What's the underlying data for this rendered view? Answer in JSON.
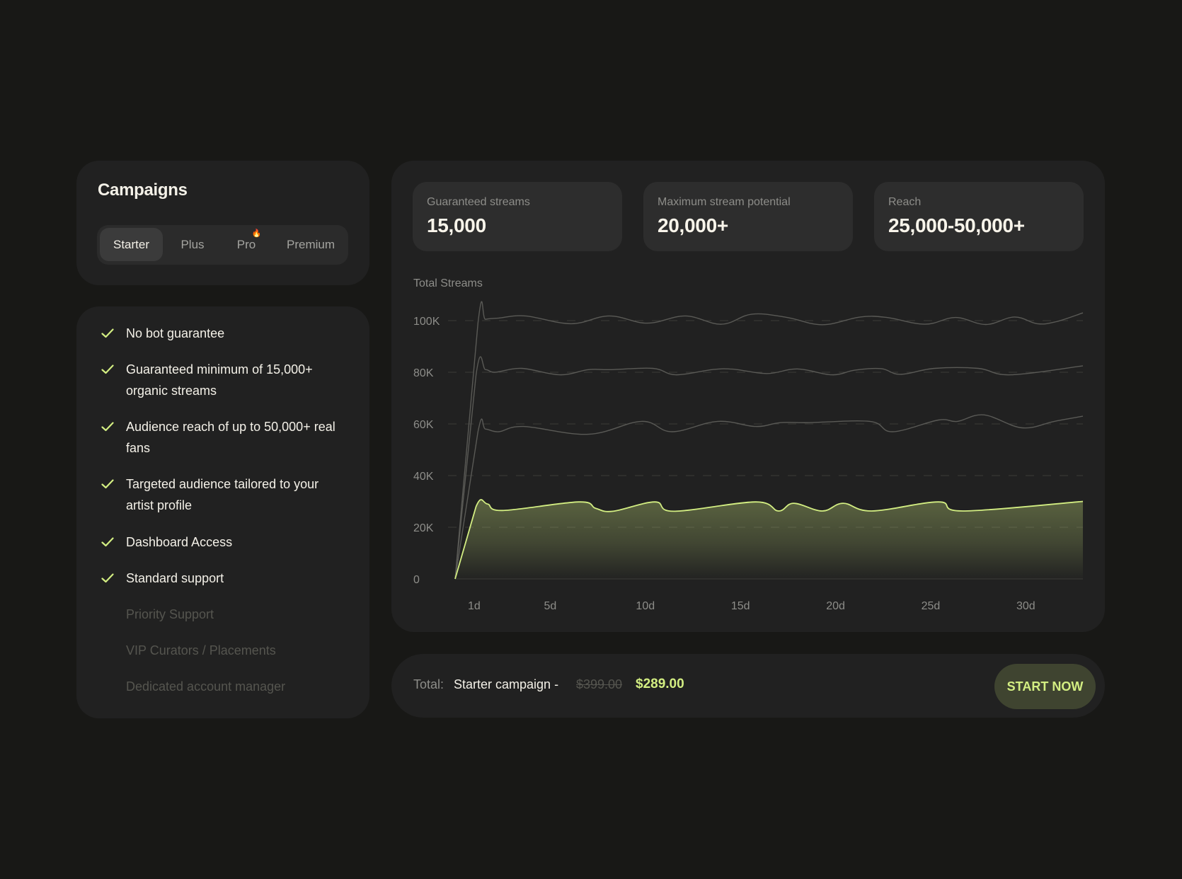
{
  "campaigns": {
    "title": "Campaigns",
    "tabs": [
      {
        "label": "Starter",
        "active": true,
        "badge": ""
      },
      {
        "label": "Plus",
        "active": false,
        "badge": ""
      },
      {
        "label": "Pro",
        "active": false,
        "badge": "🔥"
      },
      {
        "label": "Premium",
        "active": false,
        "badge": ""
      }
    ]
  },
  "features": [
    {
      "label": "No bot guarantee",
      "included": true
    },
    {
      "label": "Guaranteed minimum of 15,000+ organic streams",
      "included": true
    },
    {
      "label": "Audience reach of up to 50,000+ real fans",
      "included": true
    },
    {
      "label": "Targeted audience tailored to your artist profile",
      "included": true
    },
    {
      "label": "Dashboard Access",
      "included": true
    },
    {
      "label": "Standard support",
      "included": true
    },
    {
      "label": "Priority Support",
      "included": false
    },
    {
      "label": "VIP Curators / Placements",
      "included": false
    },
    {
      "label": "Dedicated account manager",
      "included": false
    }
  ],
  "stats": [
    {
      "label": "Guaranteed streams",
      "value": "15,000"
    },
    {
      "label": "Maximum stream potential",
      "value": "20,000+"
    },
    {
      "label": "Reach",
      "value": "25,000-50,000+"
    }
  ],
  "footer": {
    "total_label": "Total:",
    "campaign_name": "Starter campaign -",
    "old_price": "$399.00",
    "new_price": "$289.00",
    "cta_label": "START NOW"
  },
  "colors": {
    "accent": "#d3ee82",
    "muted_line": "#5a5a56",
    "card": "#212121",
    "background": "#181816"
  },
  "chart_data": {
    "type": "area",
    "title": "Total Streams",
    "xlabel": "",
    "ylabel": "",
    "ylim": [
      0,
      100000
    ],
    "xlim": [
      0,
      33
    ],
    "grid": true,
    "y_ticks": [
      0,
      20000,
      40000,
      60000,
      80000,
      100000
    ],
    "y_tick_labels": [
      "0",
      "20K",
      "40K",
      "60K",
      "80K",
      "100K"
    ],
    "x_ticks": [
      1,
      5,
      10,
      15,
      20,
      25,
      30
    ],
    "x_tick_labels": [
      "1d",
      "5d",
      "10d",
      "15d",
      "20d",
      "25d",
      "30d"
    ],
    "series": [
      {
        "name": "Starter",
        "highlighted": true,
        "x": [
          0,
          1.1,
          1.7,
          2.5,
          6.5,
          7.4,
          8.3,
          10.5,
          11.5,
          15.8,
          17.0,
          17.8,
          19.3,
          20.4,
          21.9,
          25.4,
          26.7,
          33
        ],
        "values": [
          0,
          28000,
          29000,
          26500,
          29800,
          27300,
          26200,
          29800,
          26200,
          29800,
          26300,
          29300,
          26300,
          29300,
          26300,
          29800,
          26300,
          30000
        ]
      },
      {
        "name": "Plus",
        "highlighted": false,
        "x": [
          0,
          1.2,
          1.6,
          2.3,
          3.6,
          7.0,
          9.8,
          11.4,
          13.8,
          15.8,
          17.1,
          18.6,
          21.8,
          23.0,
          25.4,
          26.4,
          27.8,
          29.8,
          31.5,
          33
        ],
        "values": [
          0,
          57000,
          58000,
          57000,
          59000,
          56000,
          61000,
          57000,
          61000,
          59000,
          60500,
          60500,
          61000,
          57000,
          61500,
          61000,
          63500,
          58500,
          61000,
          63000
        ]
      },
      {
        "name": "Pro",
        "highlighted": false,
        "x": [
          0,
          1.1,
          1.6,
          2.1,
          3.5,
          5.5,
          7.0,
          8.2,
          10.4,
          11.6,
          13.5,
          14.6,
          16.4,
          18.0,
          19.8,
          21.0,
          22.4,
          23.4,
          25.2,
          27.5,
          29.2,
          33
        ],
        "values": [
          0,
          79000,
          81000,
          80000,
          81500,
          79000,
          81000,
          81000,
          81500,
          79000,
          81000,
          81200,
          79500,
          81300,
          79000,
          80800,
          81400,
          79200,
          81500,
          81500,
          79000,
          82500
        ]
      },
      {
        "name": "Premium",
        "highlighted": false,
        "x": [
          0,
          1.2,
          1.6,
          2.3,
          3.7,
          6.1,
          8.1,
          10.1,
          12.1,
          14.0,
          15.6,
          17.4,
          19.3,
          21.3,
          22.7,
          24.7,
          26.3,
          27.9,
          29.4,
          30.6,
          31.6,
          33
        ],
        "values": [
          0,
          99000,
          100500,
          101000,
          101800,
          98800,
          101800,
          99000,
          101800,
          98600,
          102500,
          101300,
          98400,
          101400,
          101200,
          98600,
          101200,
          98500,
          101400,
          98800,
          99600,
          103000
        ]
      }
    ]
  }
}
